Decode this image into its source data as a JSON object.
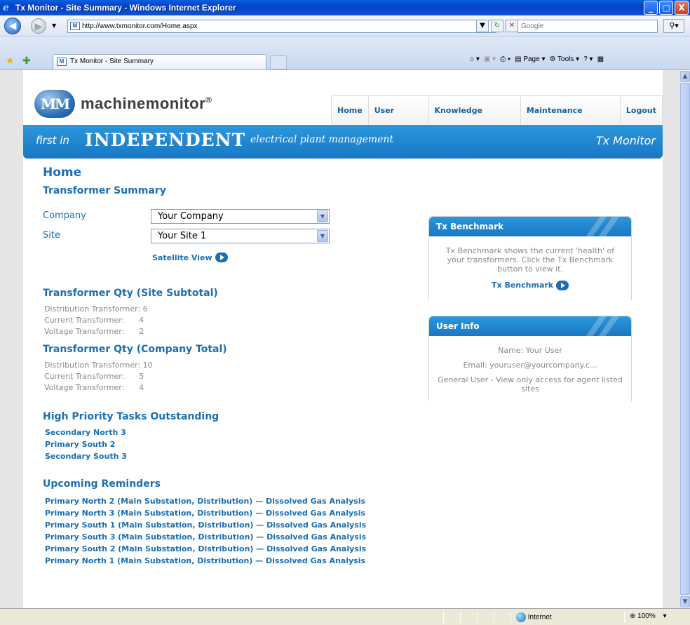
{
  "window": {
    "title": "Tx Monitor  - Site Summary - Windows Internet Explorer",
    "min": "_",
    "max": "□",
    "close": "X"
  },
  "address": {
    "url": "http://www.txmonitor.com/Home.aspx",
    "search_placeholder": "Google"
  },
  "tabs": [
    {
      "label": "Tx Monitor  - Site Summary"
    }
  ],
  "commands": {
    "page": "Page",
    "tools": "Tools"
  },
  "header": {
    "logo_mark": "MM",
    "brand": "machinemonitor",
    "reg": "®",
    "menu": [
      "Home",
      "User Profile",
      "Knowledge Monitor",
      "Maintenance Monitor",
      "Logout"
    ],
    "tag_first": "first in",
    "tag_independent": "INDEPENDENT",
    "tag_rest": "electrical plant management",
    "tag_product": "Tx Monitor"
  },
  "main": {
    "heading": "Home",
    "subheading": "Transformer Summary",
    "company_label": "Company",
    "company_value": "Your Company",
    "site_label": "Site",
    "site_value": "Your Site 1",
    "satellite_view": "Satellite View",
    "site_subtotal_title": "Transformer Qty (Site Subtotal)",
    "site_subtotal": [
      "Distribution Transformer: 6",
      "Current Transformer:      4",
      "Voltage Transformer:      2"
    ],
    "company_total_title": "Transformer Qty (Company Total)",
    "company_total": [
      "Distribution Transformer: 10",
      "Current Transformer:      5",
      "Voltage Transformer:      4"
    ],
    "tasks_title": "High Priority Tasks Outstanding",
    "tasks": [
      "Secondary North 3",
      "Primary South 2",
      "Secondary South 3"
    ],
    "reminders_title": "Upcoming Reminders",
    "reminders": [
      "Primary North 2 (Main Substation, Distribution) — Dissolved Gas Analysis",
      "Primary North 3 (Main Substation, Distribution) — Dissolved Gas Analysis",
      "Primary South 1 (Main Substation, Distribution) — Dissolved Gas Analysis",
      "Primary South 3 (Main Substation, Distribution) — Dissolved Gas Analysis",
      "Primary South 2 (Main Substation, Distribution) — Dissolved Gas Analysis",
      "Primary North 1 (Main Substation, Distribution) — Dissolved Gas Analysis"
    ]
  },
  "benchmark": {
    "title": "Tx Benchmark",
    "text": "Tx Benchmark shows the current 'health' of your transformers. Click the Tx Benchmark button to view it.",
    "button": "Tx Benchmark"
  },
  "userinfo": {
    "title": "User Info",
    "name": "Name: Your User",
    "email": "Email: youruser@yourcompany.c...",
    "role": "General User - View only access for agent listed sites"
  },
  "status": {
    "zone": "Internet",
    "zoom": "100%"
  }
}
